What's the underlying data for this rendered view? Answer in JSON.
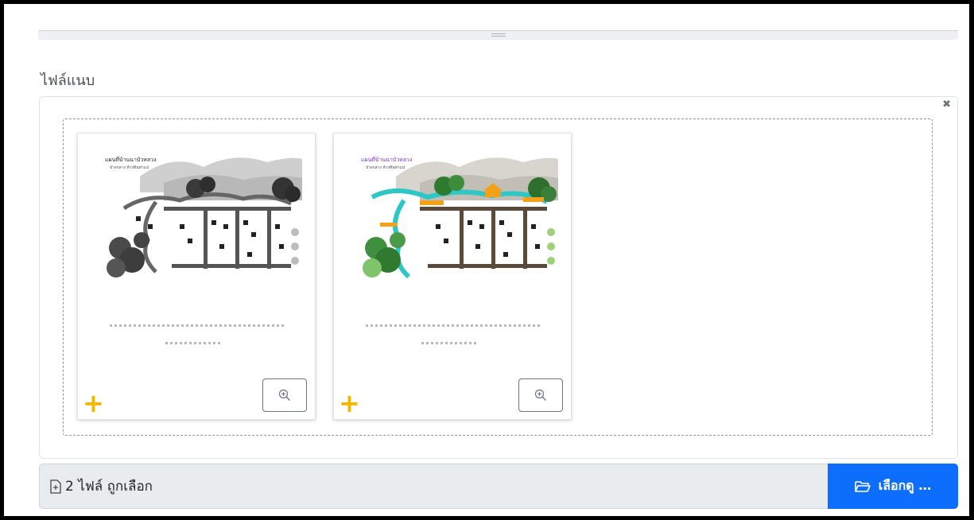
{
  "section_label": "ไฟล์แนบ",
  "preview": {
    "close_icon": "remove-icon",
    "thumbnails": [
      {
        "map_title": "แผนที่บ้านนาบัวหลวง",
        "map_subtitle": "ป่างกลาง ห้างหินท่าแป",
        "scheme": "gray",
        "actions": {
          "plus_icon": "plus-icon",
          "zoom_icon": "zoom-in-icon"
        }
      },
      {
        "map_title": "แผนที่บ้านนาบัวหลวง",
        "map_subtitle": "ป่างกลาง ห้างหินท่าแป",
        "scheme": "color",
        "actions": {
          "plus_icon": "plus-icon",
          "zoom_icon": "zoom-in-icon"
        }
      }
    ]
  },
  "file_input": {
    "file_count_icon": "file-plus-icon",
    "caption": "2 ไฟล์ ถูกเลือก",
    "browse_label": "เลือกดู …",
    "browse_icon": "folder-open-icon"
  },
  "colors": {
    "accent": "#0d6efd",
    "plus": "#f2b600",
    "river": "#2fc6c6",
    "roof": "#f2a21a"
  }
}
